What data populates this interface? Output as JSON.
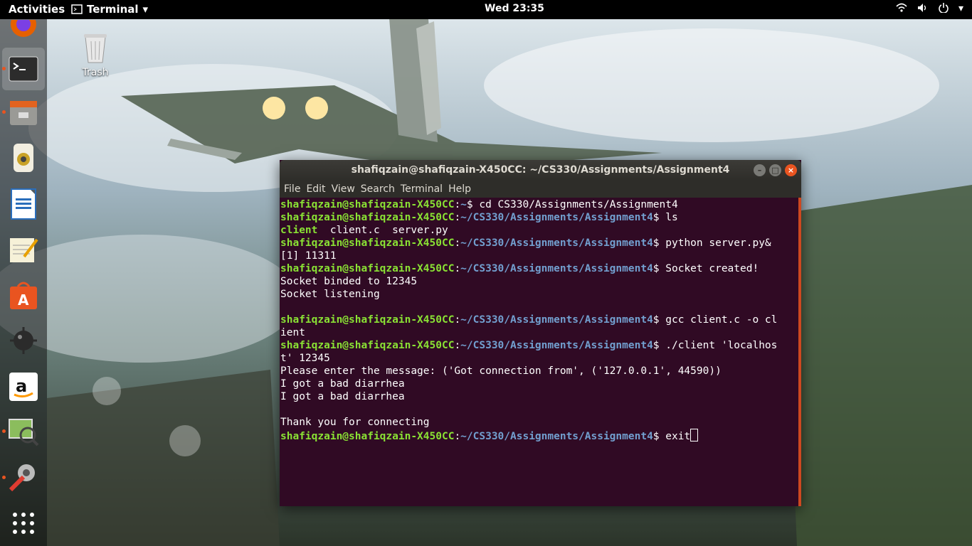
{
  "topbar": {
    "activities": "Activities",
    "app_name": "Terminal",
    "clock": "Wed 23:35"
  },
  "desktop": {
    "trash_label": "Trash"
  },
  "dock": {
    "items": [
      {
        "name": "firefox-icon"
      },
      {
        "name": "terminal-icon"
      },
      {
        "name": "files-icon"
      },
      {
        "name": "rhythmbox-icon"
      },
      {
        "name": "libreoffice-writer-icon"
      },
      {
        "name": "text-editor-icon"
      },
      {
        "name": "software-center-icon"
      },
      {
        "name": "mines-icon"
      },
      {
        "name": "amazon-icon"
      },
      {
        "name": "image-viewer-icon"
      },
      {
        "name": "settings-icon"
      },
      {
        "name": "app-grid-icon"
      }
    ]
  },
  "window": {
    "title": "shafiqzain@shafiqzain-X450CC: ~/CS330/Assignments/Assignment4",
    "menu": [
      "File",
      "Edit",
      "View",
      "Search",
      "Terminal",
      "Help"
    ]
  },
  "terminal": {
    "user": "shafiqzain@shafiqzain-X450CC",
    "path": "~/CS330/Assignments/Assignment4",
    "lines": [
      {
        "kind": "prompt",
        "path": "~",
        "cmd": "$ cd CS330/Assignments/Assignment4"
      },
      {
        "kind": "prompt",
        "path": "~/CS330/Assignments/Assignment4",
        "cmd": "$ ls"
      },
      {
        "kind": "ls",
        "dir": "client",
        "rest": "  client.c  server.py"
      },
      {
        "kind": "prompt",
        "path": "~/CS330/Assignments/Assignment4",
        "cmd": "$ python server.py&"
      },
      {
        "kind": "text",
        "text": "[1] 11311"
      },
      {
        "kind": "prompt",
        "path": "~/CS330/Assignments/Assignment4",
        "cmd": "$ Socket created!"
      },
      {
        "kind": "text",
        "text": "Socket binded to 12345"
      },
      {
        "kind": "text",
        "text": "Socket listening"
      },
      {
        "kind": "text",
        "text": ""
      },
      {
        "kind": "prompt",
        "path": "~/CS330/Assignments/Assignment4",
        "cmd": "$ gcc client.c -o cl"
      },
      {
        "kind": "text",
        "text": "ient"
      },
      {
        "kind": "prompt",
        "path": "~/CS330/Assignments/Assignment4",
        "cmd": "$ ./client 'localhos"
      },
      {
        "kind": "text",
        "text": "t' 12345"
      },
      {
        "kind": "text",
        "text": "Please enter the message: ('Got connection from', ('127.0.0.1', 44590))"
      },
      {
        "kind": "text",
        "text": "I got a bad diarrhea"
      },
      {
        "kind": "text",
        "text": "I got a bad diarrhea"
      },
      {
        "kind": "text",
        "text": ""
      },
      {
        "kind": "text",
        "text": "Thank you for connecting"
      },
      {
        "kind": "prompt",
        "path": "~/CS330/Assignments/Assignment4",
        "cmd": "$ exit",
        "cursor": true
      }
    ]
  }
}
